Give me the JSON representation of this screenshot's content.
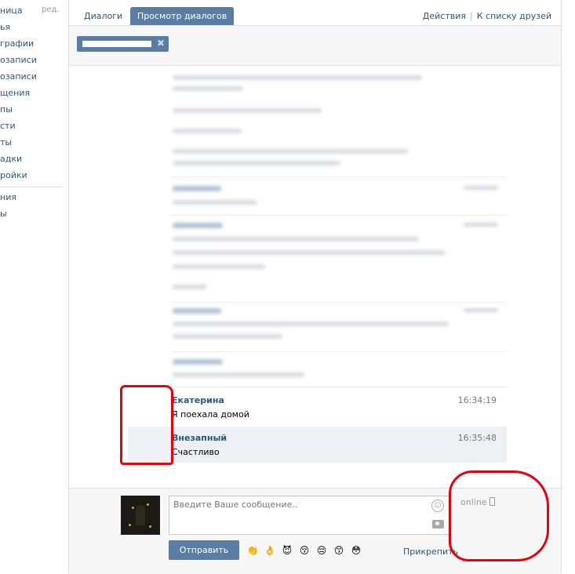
{
  "left_menu": {
    "edit_label": "ред.",
    "items": [
      {
        "label": "ница"
      },
      {
        "label": "ья"
      },
      {
        "label": "графии"
      },
      {
        "label": "озаписи"
      },
      {
        "label": "озаписи"
      },
      {
        "label": "щения"
      },
      {
        "label": "пы"
      },
      {
        "label": "сти"
      },
      {
        "label": "ты"
      },
      {
        "label": "адки"
      },
      {
        "label": "ройки"
      },
      {
        "label": "ния"
      },
      {
        "label": "ы"
      }
    ]
  },
  "tabs": [
    {
      "label": "Диалоги"
    },
    {
      "label": "Просмотр диалогов"
    }
  ],
  "tab_actions": {
    "actions_label": "Действия",
    "separator": "|",
    "friends_label": "К списку друзей"
  },
  "peer_token": {
    "remove_symbol": "✖"
  },
  "messages": [
    {
      "author": "Екатерина",
      "text": "Я поехала домой",
      "time": "16:34:19"
    },
    {
      "author": "Внезапный",
      "text": "Счастливо",
      "time": "16:35:48"
    }
  ],
  "compose": {
    "placeholder": "Введите Ваше сообщение..",
    "status": "online",
    "send_label": "Отправить",
    "attach_label": "Прикрепить",
    "emoji": [
      "👏",
      "👌",
      "😈",
      "😚",
      "😔",
      "😙",
      "😳"
    ]
  },
  "colors": {
    "link": "#2b587a",
    "accent": "#597da3",
    "annotation": "#e8000b"
  }
}
